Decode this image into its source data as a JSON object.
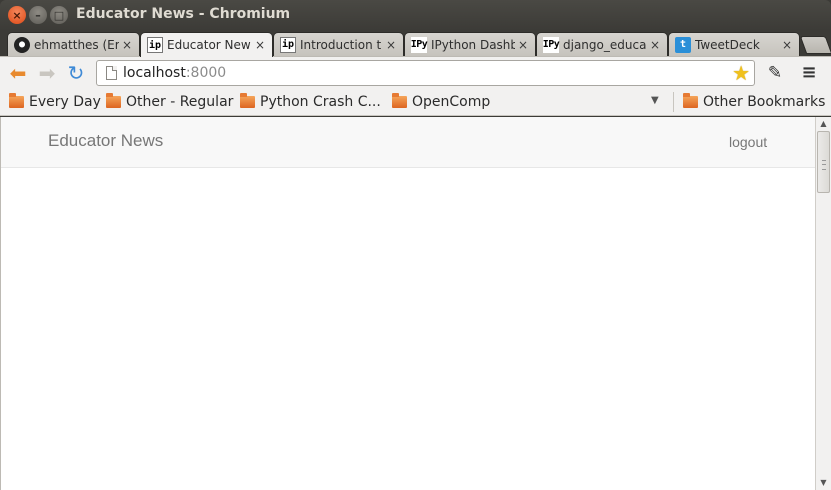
{
  "window": {
    "title": "Educator News - Chromium",
    "buttons": {
      "close": "×",
      "minimize": "–",
      "maximize": "□"
    }
  },
  "tabs": [
    {
      "label": "ehmatthes (Er",
      "favicon": "github-icon",
      "active": false
    },
    {
      "label": "Educator New",
      "favicon": "ip-icon",
      "active": true
    },
    {
      "label": "Introduction t",
      "favicon": "ip-icon",
      "active": false
    },
    {
      "label": "IPython Dashb",
      "favicon": "ipy-icon",
      "active": false
    },
    {
      "label": "django_educa",
      "favicon": "ipy-icon",
      "active": false
    },
    {
      "label": "TweetDeck",
      "favicon": "twitter-icon",
      "active": false
    }
  ],
  "tab_close": "×",
  "favicon_text": {
    "ip": "ip",
    "ipy": "IPy",
    "github": "●",
    "twitter": "t"
  },
  "toolbar": {
    "url_host": "localhost",
    "url_port": ":8000",
    "back_glyph": "⬅",
    "forward_glyph": "➡",
    "reload_glyph": "↻",
    "star_glyph": "★",
    "dropper_glyph": "✎",
    "menu_glyph": "≡"
  },
  "bookmarks": {
    "items": [
      {
        "label": "Every Day"
      },
      {
        "label": "Other - Regular"
      },
      {
        "label": "Python Crash C..."
      },
      {
        "label": "OpenComp"
      }
    ],
    "other": "Other Bookmarks",
    "chevron": "▼"
  },
  "page": {
    "brand": "Educator News",
    "logout": "logout"
  },
  "scrollbar": {
    "up": "▲",
    "down": "▼"
  }
}
